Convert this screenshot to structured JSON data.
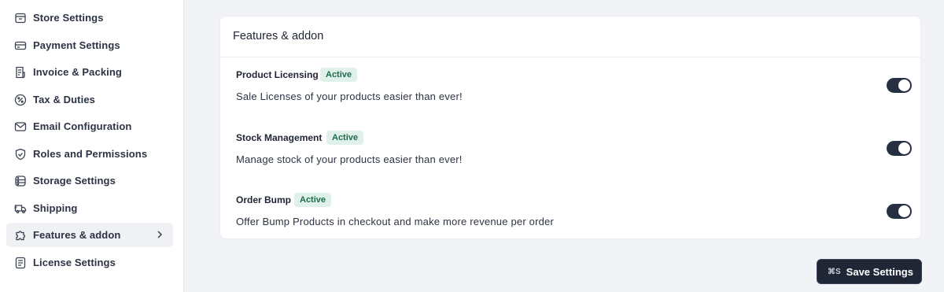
{
  "sidebar": {
    "items": [
      {
        "label": "Store Settings",
        "icon": "store-icon"
      },
      {
        "label": "Payment Settings",
        "icon": "credit-card-icon"
      },
      {
        "label": "Invoice & Packing",
        "icon": "invoice-icon"
      },
      {
        "label": "Tax & Duties",
        "icon": "percent-icon"
      },
      {
        "label": "Email Configuration",
        "icon": "mail-icon"
      },
      {
        "label": "Roles and Permissions",
        "icon": "shield-icon"
      },
      {
        "label": "Storage Settings",
        "icon": "storage-icon"
      },
      {
        "label": "Shipping",
        "icon": "truck-icon"
      },
      {
        "label": "Features & addon",
        "icon": "puzzle-icon",
        "active": true
      },
      {
        "label": "License Settings",
        "icon": "document-icon"
      }
    ]
  },
  "panel": {
    "title": "Features & addon",
    "features": [
      {
        "name": "Product Licensing",
        "status": "Active",
        "description": "Sale Licenses of your products easier than ever!",
        "enabled": true
      },
      {
        "name": "Stock Management",
        "status": "Active",
        "description": "Manage stock of your products easier than ever!",
        "enabled": true
      },
      {
        "name": "Order Bump",
        "status": "Active",
        "description": "Offer Bump Products in checkout and make more revenue per order",
        "enabled": true
      }
    ]
  },
  "footer": {
    "save_shortcut": "⌘S",
    "save_label": "Save Settings"
  },
  "colors": {
    "active_badge_bg": "#dff1ea",
    "active_badge_text": "#1d6b4a",
    "toggle_on": "#263042",
    "primary_button": "#1f2737"
  }
}
